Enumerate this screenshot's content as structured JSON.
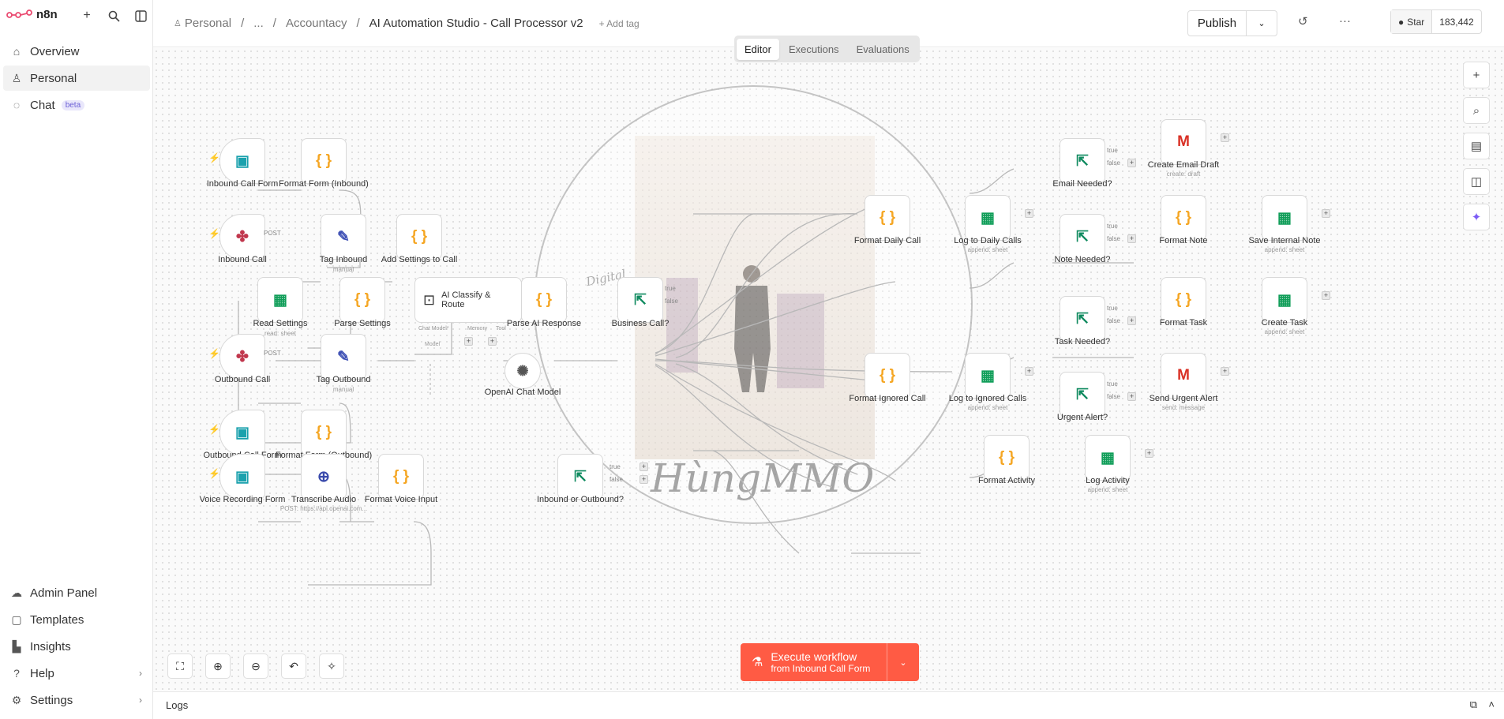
{
  "app": {
    "name": "n8n"
  },
  "sidebar": {
    "items": [
      {
        "label": "Overview",
        "icon": "home-icon"
      },
      {
        "label": "Personal",
        "icon": "user-icon"
      },
      {
        "label": "Chat",
        "icon": "chat-icon",
        "badge": "beta"
      }
    ],
    "bottom": [
      {
        "label": "Admin Panel",
        "icon": "cloud-icon"
      },
      {
        "label": "Templates",
        "icon": "box-icon"
      },
      {
        "label": "Insights",
        "icon": "chart-icon"
      },
      {
        "label": "Help",
        "icon": "help-icon"
      },
      {
        "label": "Settings",
        "icon": "gear-icon"
      }
    ]
  },
  "header": {
    "breadcrumb": [
      "Personal",
      "...",
      "Accountacy"
    ],
    "title": "AI Automation Studio - Call Processor v2",
    "add_tag": "+ Add tag",
    "publish": "Publish",
    "github": {
      "star": "Star",
      "count": "183,442"
    }
  },
  "tabs": [
    "Editor",
    "Executions",
    "Evaluations"
  ],
  "nodes": {
    "inbound_call_form": "Inbound Call Form",
    "format_form_inbound": "Format Form (Inbound)",
    "inbound_call": "Inbound Call",
    "tag_inbound": "Tag Inbound",
    "tag_inbound_sub": "manual",
    "add_settings": "Add Settings to Call",
    "read_settings": "Read Settings",
    "read_settings_sub": "read: sheet",
    "parse_settings": "Parse Settings",
    "ai_classify": "AI Classify & Route",
    "parse_ai": "Parse AI Response",
    "business_call": "Business Call?",
    "outbound_call": "Outbound Call",
    "tag_outbound": "Tag Outbound",
    "tag_outbound_sub": "manual",
    "openai_model": "OpenAI Chat Model",
    "outbound_call_form": "Outbound Call Form",
    "format_form_outbound": "Format Form (Outbound)",
    "voice_recording_form": "Voice Recording Form",
    "transcribe_audio": "Transcribe Audio",
    "transcribe_sub": "POST: https://api.openai.com...",
    "format_voice": "Format Voice Input",
    "inbound_or_outbound": "Inbound or Outbound?",
    "format_daily": "Format Daily Call",
    "log_daily": "Log to Daily Calls",
    "log_daily_sub": "append: sheet",
    "format_ignored": "Format Ignored Call",
    "log_ignored": "Log to Ignored Calls",
    "log_ignored_sub": "append: sheet",
    "format_activity": "Format Activity",
    "log_activity": "Log Activity",
    "log_activity_sub": "append: sheet",
    "email_needed": "Email Needed?",
    "create_email": "Create Email Draft",
    "create_email_sub": "create: draft",
    "note_needed": "Note Needed?",
    "format_note": "Format Note",
    "save_note": "Save Internal Note",
    "save_note_sub": "append: sheet",
    "task_needed": "Task Needed?",
    "format_task": "Format Task",
    "create_task": "Create Task",
    "create_task_sub": "append: sheet",
    "urgent_alert": "Urgent Alert?",
    "send_alert": "Send Urgent Alert",
    "send_alert_sub": "send: message",
    "post": "POST",
    "true": "true",
    "false": "false",
    "chat_model": "Chat Model*",
    "memory": "Memory",
    "tool": "Tool",
    "model": "Model"
  },
  "watermark": {
    "text": "HùngMMO",
    "logo": "Digital"
  },
  "execute": {
    "label": "Execute workflow",
    "sub": "from Inbound Call Form"
  },
  "logs": {
    "label": "Logs"
  },
  "colors": {
    "accent": "#ff5b44",
    "code": "#f5a623",
    "sheets": "#0f9d58",
    "if": "#0f8a5f",
    "webhook": "#c1374d",
    "form": "#1aa1ad"
  }
}
